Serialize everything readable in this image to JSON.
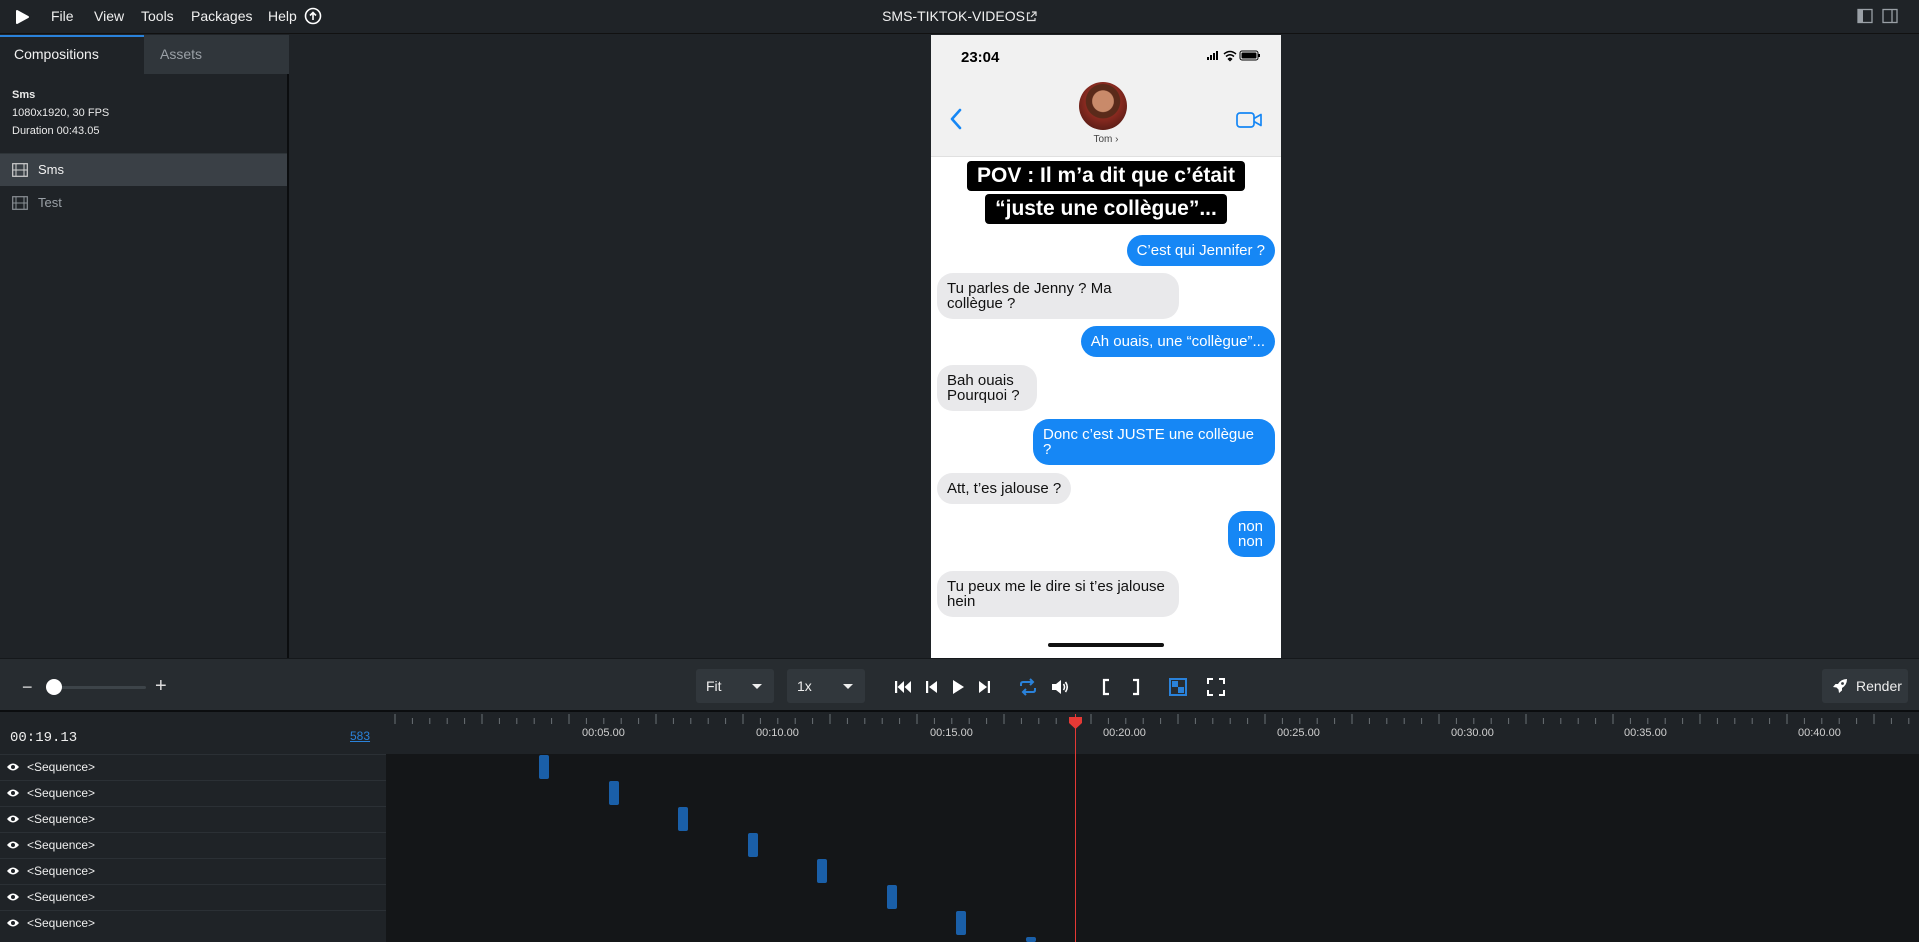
{
  "menu": {
    "items": [
      "File",
      "View",
      "Tools",
      "Packages",
      "Help"
    ],
    "project_title": "SMS-TIKTOK-VIDEOS"
  },
  "sidebar": {
    "tabs": [
      "Compositions",
      "Assets"
    ],
    "composition": {
      "name": "Sms",
      "resolution": "1080x1920, 30 FPS",
      "duration": "Duration 00:43.05"
    },
    "items": [
      {
        "label": "Sms",
        "active": true
      },
      {
        "label": "Test",
        "active": false
      }
    ]
  },
  "phone": {
    "status_time": "23:04",
    "contact_name": "Tom ›",
    "caption_lines": [
      "POV : Il m’a dit que c’était",
      "“juste une collègue”..."
    ],
    "messages": [
      {
        "from": "me",
        "text": "C’est qui Jennifer ?"
      },
      {
        "from": "them",
        "text": "Tu parles de Jenny ? Ma collègue ?"
      },
      {
        "from": "me",
        "text": "Ah ouais, une “collègue”..."
      },
      {
        "from": "them",
        "text": "Bah ouais Pourquoi ?"
      },
      {
        "from": "me",
        "text": "Donc c’est JUSTE une collègue ?"
      },
      {
        "from": "them",
        "text": "Att, t’es jalouse ?"
      },
      {
        "from": "me",
        "text": "non non"
      },
      {
        "from": "them",
        "text": "Tu peux me le dire si t’es jalouse hein"
      }
    ]
  },
  "controls": {
    "fit_select": "Fit",
    "speed_select": "1x",
    "render_label": "Render",
    "accent": "#2a82da"
  },
  "timeline": {
    "current_time": "00:19.13",
    "current_frame": "583",
    "ruler_labels": [
      "00:05.00",
      "00:10.00",
      "00:15.00",
      "00:20.00",
      "00:25.00",
      "00:30.00",
      "00:35.00",
      "00:40.00"
    ],
    "tracks": [
      "<Sequence>",
      "<Sequence>",
      "<Sequence>",
      "<Sequence>",
      "<Sequence>",
      "<Sequence>",
      "<Sequence>"
    ],
    "playhead_color": "#e53935"
  }
}
